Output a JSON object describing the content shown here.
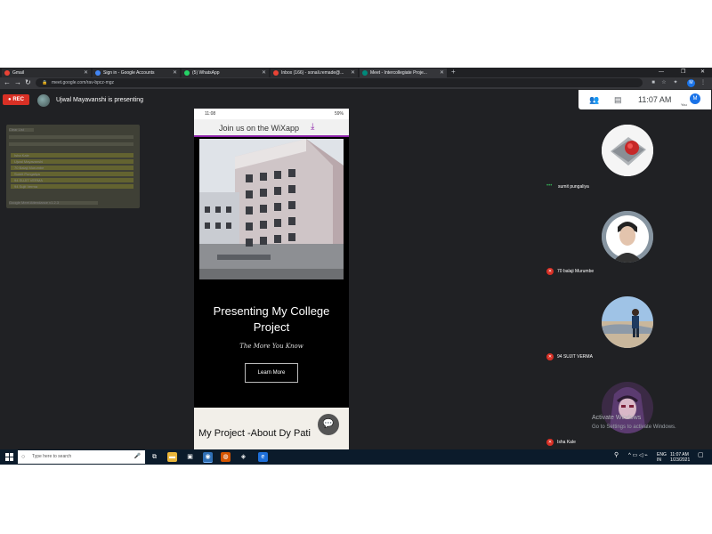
{
  "browser": {
    "tabs": [
      {
        "label": "Gmail",
        "color": "#ea4335",
        "active": false
      },
      {
        "label": "Sign in - Google Accounts",
        "color": "#4285f4",
        "active": false
      },
      {
        "label": "(5) WhatsApp",
        "color": "#25d366",
        "active": false
      },
      {
        "label": "Inbox (166) - sonali.remade@...",
        "color": "#ea4335",
        "active": false
      },
      {
        "label": "Meet - Intercollegiate Proje...",
        "color": "#00897b",
        "active": true
      }
    ],
    "new_tab": "+",
    "url": "meet.google.com/rav-bpcz-mgz"
  },
  "meet": {
    "rec_label": "REC",
    "presenting_text": "Ujwal Mayavanshi is presenting",
    "time": "11:07 AM",
    "me_initial": "M",
    "you_label": "You"
  },
  "ghost_panel": {
    "header": "Clear List",
    "rows": [
      "Isha Kale",
      "Ujwal Mayavanshi",
      "70 Balaji Murumbe",
      "Sumit Pungaliya",
      "94 SUJIT VERMA",
      "94 Sujit Verma"
    ],
    "footer": "Google Meet Attendance v1.2.3"
  },
  "phone": {
    "status_time": "11:08",
    "status_right": "59%",
    "banner": "Join us on the WiXapp",
    "hero_title_1": "Presenting My College",
    "hero_title_2": "Project",
    "tagline": "The More You Know",
    "button": "Learn More",
    "section_heading": "My Project -About Dy Pati"
  },
  "participants": [
    {
      "name": "sumit pungaliya",
      "muted": false
    },
    {
      "name": "70 balaji Murumbe",
      "muted": true
    },
    {
      "name": "94 SUJIT VERMA",
      "muted": true
    },
    {
      "name": "Isha Kale",
      "muted": true
    }
  ],
  "activate": {
    "line1": "Activate Windows",
    "line2": "Go to Settings to activate Windows."
  },
  "taskbar": {
    "search_placeholder": "Type here to search",
    "lang": "ENG",
    "region": "IN",
    "time": "11:07 AM",
    "date": "1/23/2021"
  }
}
